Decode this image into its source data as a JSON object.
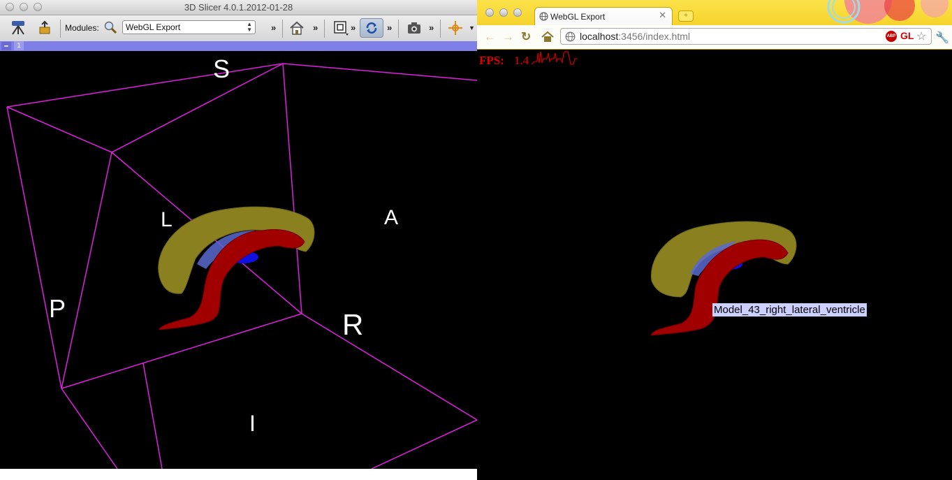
{
  "slicer": {
    "window_title": "3D Slicer 4.0.1.2012-01-28",
    "modules_label": "Modules:",
    "module_selected": "WebGL Export",
    "view_number": "1",
    "toolbar_chevron": "»",
    "axis_labels": {
      "superior": "S",
      "inferior": "I",
      "left": "L",
      "right": "R",
      "anterior": "A",
      "posterior": "P"
    },
    "colors": {
      "bounding_box": "#e020e0",
      "caudate": "#8a8020",
      "ventricle_red": "#a00000",
      "ventricle_blue": "#1010e0",
      "view_bar": "#7f7fe8"
    }
  },
  "browser": {
    "tab_title": "WebGL Export",
    "tab_close": "✕",
    "url_host": "localhost",
    "url_rest": ":3456/index.html",
    "abp_label": "ABP",
    "gl_badge": "GL",
    "fps_label": "FPS:",
    "fps_value": "1.4",
    "tooltip": "Model_43_right_lateral_ventricle",
    "colors": {
      "chrome_yellow": "#f5cf1c",
      "fps_red": "#e00000",
      "tooltip_bg": "#ccd0ff"
    }
  }
}
